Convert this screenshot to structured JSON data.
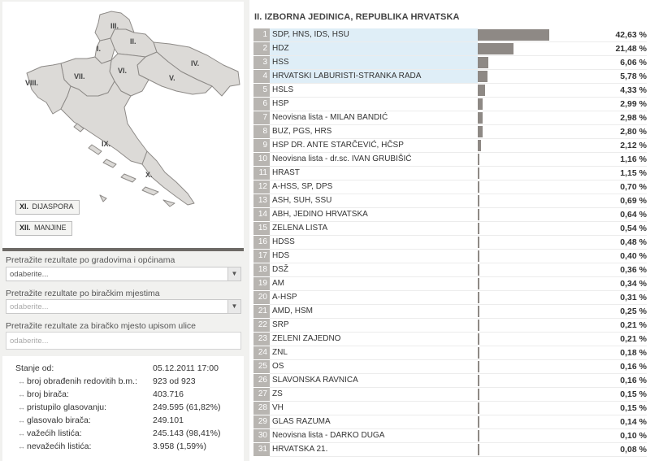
{
  "map": {
    "regions": [
      "I.",
      "II.",
      "III.",
      "IV.",
      "V.",
      "VI.",
      "VII.",
      "VIII.",
      "IX.",
      "X."
    ],
    "extra_buttons": [
      {
        "code": "XI.",
        "label": "DIJASPORA"
      },
      {
        "code": "XII.",
        "label": "MANJINE"
      }
    ]
  },
  "search": {
    "city_label": "Pretražite rezultate po gradovima i općinama",
    "city_value": "odaberite...",
    "station_label": "Pretražite rezultate po biračkim mjestima",
    "station_value": "odaberite...",
    "street_label": "Pretražite rezultate za biračko mjesto upisom ulice",
    "street_placeholder": "odaberite..."
  },
  "stats": [
    {
      "key": "Stanje od:",
      "value": "05.12.2011 17:00",
      "arrow": false
    },
    {
      "key": "broj obrađenih redovitih b.m.:",
      "value": "923 od 923",
      "arrow": true
    },
    {
      "key": "broj birača:",
      "value": "403.716",
      "arrow": true
    },
    {
      "key": "pristupilo glasovanju:",
      "value": "249.595 (61,82%)",
      "arrow": true
    },
    {
      "key": "glasovalo birača:",
      "value": "249.101",
      "arrow": true
    },
    {
      "key": "važećih listića:",
      "value": "245.143 (98,41%)",
      "arrow": true
    },
    {
      "key": "nevažećih listića:",
      "value": "3.958 (1,59%)",
      "arrow": true
    }
  ],
  "results": {
    "title": "II. IZBORNA JEDINICA, REPUBLIKA HRVATSKA",
    "rows": [
      {
        "num": "1",
        "name": "SDP, HNS, IDS, HSU",
        "pct": "42,63 %",
        "value": 42.63,
        "highlight": true
      },
      {
        "num": "2",
        "name": "HDZ",
        "pct": "21,48 %",
        "value": 21.48,
        "highlight": true
      },
      {
        "num": "3",
        "name": "HSS",
        "pct": "6,06 %",
        "value": 6.06,
        "highlight": true
      },
      {
        "num": "4",
        "name": "HRVATSKI LABURISTI-STRANKA RADA",
        "pct": "5,78 %",
        "value": 5.78,
        "highlight": true
      },
      {
        "num": "5",
        "name": "HSLS",
        "pct": "4,33 %",
        "value": 4.33,
        "highlight": false
      },
      {
        "num": "6",
        "name": "HSP",
        "pct": "2,99 %",
        "value": 2.99,
        "highlight": false
      },
      {
        "num": "7",
        "name": "Neovisna lista - MILAN BANDIĆ",
        "pct": "2,98 %",
        "value": 2.98,
        "highlight": false
      },
      {
        "num": "8",
        "name": "BUZ, PGS, HRS",
        "pct": "2,80 %",
        "value": 2.8,
        "highlight": false
      },
      {
        "num": "9",
        "name": "HSP DR. ANTE STARČEVIĆ, HČSP",
        "pct": "2,12 %",
        "value": 2.12,
        "highlight": false
      },
      {
        "num": "10",
        "name": "Neovisna lista - dr.sc. IVAN GRUBIŠIĆ",
        "pct": "1,16 %",
        "value": 1.16,
        "highlight": false
      },
      {
        "num": "11",
        "name": "HRAST",
        "pct": "1,15 %",
        "value": 1.15,
        "highlight": false
      },
      {
        "num": "12",
        "name": "A-HSS, SP, DPS",
        "pct": "0,70 %",
        "value": 0.7,
        "highlight": false
      },
      {
        "num": "13",
        "name": "ASH, SUH, SSU",
        "pct": "0,69 %",
        "value": 0.69,
        "highlight": false
      },
      {
        "num": "14",
        "name": "ABH, JEDINO HRVATSKA",
        "pct": "0,64 %",
        "value": 0.64,
        "highlight": false
      },
      {
        "num": "15",
        "name": "ZELENA LISTA",
        "pct": "0,54 %",
        "value": 0.54,
        "highlight": false
      },
      {
        "num": "16",
        "name": "HDSS",
        "pct": "0,48 %",
        "value": 0.48,
        "highlight": false
      },
      {
        "num": "17",
        "name": "HDS",
        "pct": "0,40 %",
        "value": 0.4,
        "highlight": false
      },
      {
        "num": "18",
        "name": "DSŽ",
        "pct": "0,36 %",
        "value": 0.36,
        "highlight": false
      },
      {
        "num": "19",
        "name": "AM",
        "pct": "0,34 %",
        "value": 0.34,
        "highlight": false
      },
      {
        "num": "20",
        "name": "A-HSP",
        "pct": "0,31 %",
        "value": 0.31,
        "highlight": false
      },
      {
        "num": "21",
        "name": "AMD, HSM",
        "pct": "0,25 %",
        "value": 0.25,
        "highlight": false
      },
      {
        "num": "22",
        "name": "SRP",
        "pct": "0,21 %",
        "value": 0.21,
        "highlight": false
      },
      {
        "num": "23",
        "name": "ZELENI ZAJEDNO",
        "pct": "0,21 %",
        "value": 0.21,
        "highlight": false
      },
      {
        "num": "24",
        "name": "ZNL",
        "pct": "0,18 %",
        "value": 0.18,
        "highlight": false
      },
      {
        "num": "25",
        "name": "OS",
        "pct": "0,16 %",
        "value": 0.16,
        "highlight": false
      },
      {
        "num": "26",
        "name": "SLAVONSKA RAVNICA",
        "pct": "0,16 %",
        "value": 0.16,
        "highlight": false
      },
      {
        "num": "27",
        "name": "ZS",
        "pct": "0,15 %",
        "value": 0.15,
        "highlight": false
      },
      {
        "num": "28",
        "name": "VH",
        "pct": "0,15 %",
        "value": 0.15,
        "highlight": false
      },
      {
        "num": "29",
        "name": "GLAS RAZUMA",
        "pct": "0,14 %",
        "value": 0.14,
        "highlight": false
      },
      {
        "num": "30",
        "name": "Neovisna lista - DARKO DUGA",
        "pct": "0,10 %",
        "value": 0.1,
        "highlight": false
      },
      {
        "num": "31",
        "name": "HRVATSKA 21.",
        "pct": "0,08 %",
        "value": 0.08,
        "highlight": false
      }
    ]
  },
  "colors": {
    "bar": "#8e8985",
    "highlight": "#dfeef7",
    "number_cell": "#b8b5b1",
    "map_fill": "#dcdad7",
    "map_stroke": "#8d8a87"
  }
}
